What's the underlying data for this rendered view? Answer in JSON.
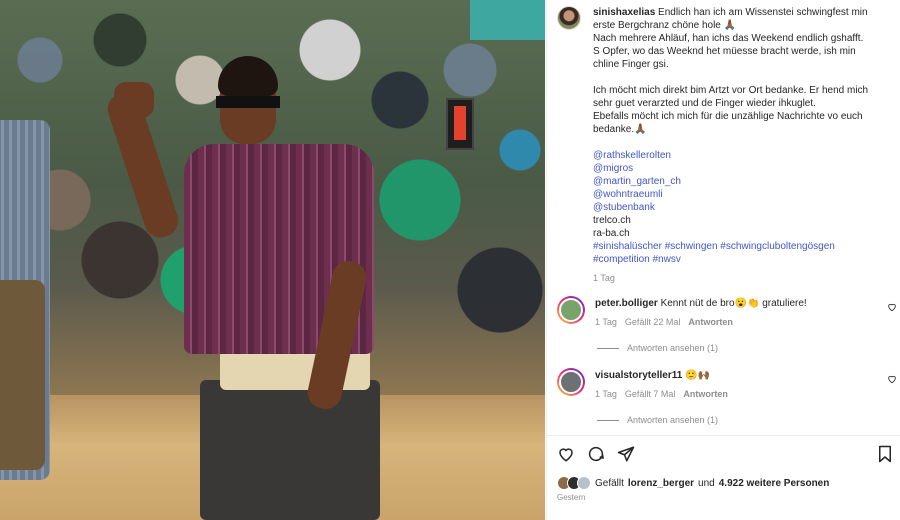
{
  "post": {
    "username": "sinishaxelias",
    "caption_lines": [
      "Endlich han ich am Wissenstei schwingfest min",
      "erste Bergchranz chöne hole 🙏🏾",
      "Nach mehrere Ahläuf, han ichs das Weekend endlich gshafft.",
      "S Opfer, wo das Weeknd het müesse bracht werde, ish min",
      "chline Finger gsi.",
      "",
      "Ich möcht mich direkt bim Artzt vor Ort bedanke. Er hend mich",
      "sehr guet verarzted und de Finger wieder ihkuglet.",
      "Ebefalls möcht ich mich für die unzählige Nachrichte vo euch",
      "bedanke.🙏🏾"
    ],
    "mentions": [
      "@rathskellerolten",
      "@migros",
      "@martin_garten_ch",
      "@wohntraeumli",
      "@stubenbank"
    ],
    "plain_lines": [
      "trelco.ch",
      "ra-ba.ch"
    ],
    "hashtags_line1": "#sinishalüscher #schwingen #schwingcluboltengösgen",
    "hashtags_line2": "#competition #nwsv",
    "time": "1 Tag"
  },
  "comments": [
    {
      "username": "peter.bolliger",
      "text": "Kennt nüt de bro😮👏 gratuliere!",
      "time": "1 Tag",
      "likes": "Gefällt 22 Mal",
      "reply": "Antworten",
      "view_replies": "Antworten ansehen (1)",
      "avatar_color": "#7aa36b"
    },
    {
      "username": "visualstoryteller11",
      "text": "🙂🙌🏾",
      "time": "1 Tag",
      "likes": "Gefällt 7 Mal",
      "reply": "Antworten",
      "view_replies": "Antworten ansehen (1)",
      "avatar_color": "#6d7176"
    }
  ],
  "footer": {
    "liked_prefix": "Gefällt",
    "liked_user": "lorenz_berger",
    "liked_mid": "und",
    "liked_count": "4.922 weitere Personen",
    "posted": "Gestern"
  },
  "icons": [
    "heart-icon",
    "comment-icon",
    "share-icon",
    "bookmark-icon"
  ]
}
